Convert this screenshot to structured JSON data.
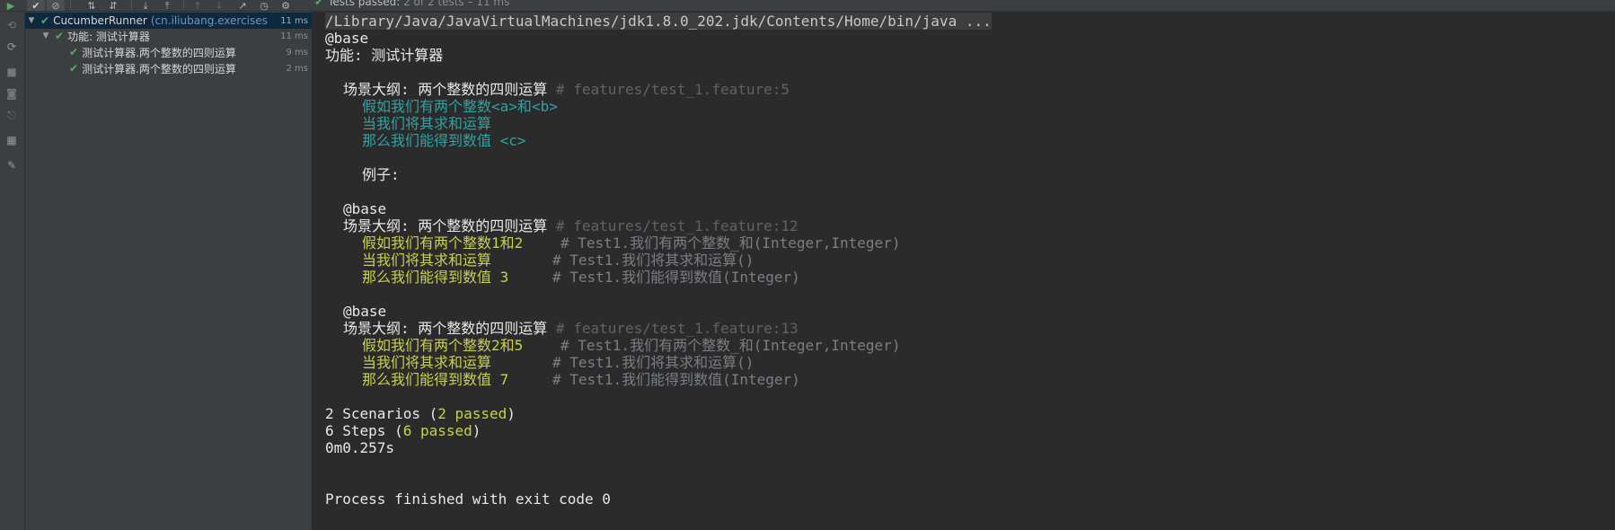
{
  "toolbar": {
    "status_check": "✔",
    "status_label": "Tests passed:",
    "status_counts": "2 of 2 tests – 11 ms"
  },
  "tree": {
    "root": {
      "label": "CucumberRunner",
      "package": "(cn.iliubang.exercises",
      "time": "11 ms"
    },
    "feature": {
      "label": "功能: 测试计算器",
      "time": "11 ms"
    },
    "scenarios": [
      {
        "label": "测试计算器.两个整数的四则运算",
        "time": "9 ms"
      },
      {
        "label": "测试计算器.两个整数的四则运算",
        "time": "2 ms"
      }
    ]
  },
  "console": {
    "cmd": "/Library/Java/JavaVirtualMachines/jdk1.8.0_202.jdk/Contents/Home/bin/java ...",
    "tag1": "@base",
    "feature_line": "功能: 测试计算器",
    "outline": {
      "title": "场景大纲: 两个整数的四则运算",
      "loc": "# features/test_1.feature:5",
      "step1_a": "假如我们有两个整数",
      "step1_b": "<a>",
      "step1_c": "和",
      "step1_d": "<b>",
      "step2": "当我们将其求和运算",
      "step3_a": "那么我们能得到数值 ",
      "step3_b": "<c>",
      "examples": "例子:"
    },
    "ex1": {
      "tag": "@base",
      "title": "场景大纲: 两个整数的四则运算",
      "loc": "# features/test_1.feature:12",
      "s1": "假如我们有两个整数1和2",
      "s1c": "# Test1.我们有两个整数_和(Integer,Integer)",
      "s2": "当我们将其求和运算",
      "s2c": "# Test1.我们将其求和运算()",
      "s3": "那么我们能得到数值 3",
      "s3c": "# Test1.我们能得到数值(Integer)"
    },
    "ex2": {
      "tag": "@base",
      "title": "场景大纲: 两个整数的四则运算",
      "loc": "# features/test_1.feature:13",
      "s1": "假如我们有两个整数2和5",
      "s1c": "# Test1.我们有两个整数_和(Integer,Integer)",
      "s2": "当我们将其求和运算",
      "s2c": "# Test1.我们将其求和运算()",
      "s3": "那么我们能得到数值 7",
      "s3c": "# Test1.我们能得到数值(Integer)"
    },
    "summary": {
      "scen_a": "2 Scenarios (",
      "scen_b": "2 passed",
      "scen_c": ")",
      "steps_a": "6 Steps (",
      "steps_b": "6 passed",
      "steps_c": ")",
      "time": "0m0.257s"
    },
    "process": "Process finished with exit code 0"
  }
}
